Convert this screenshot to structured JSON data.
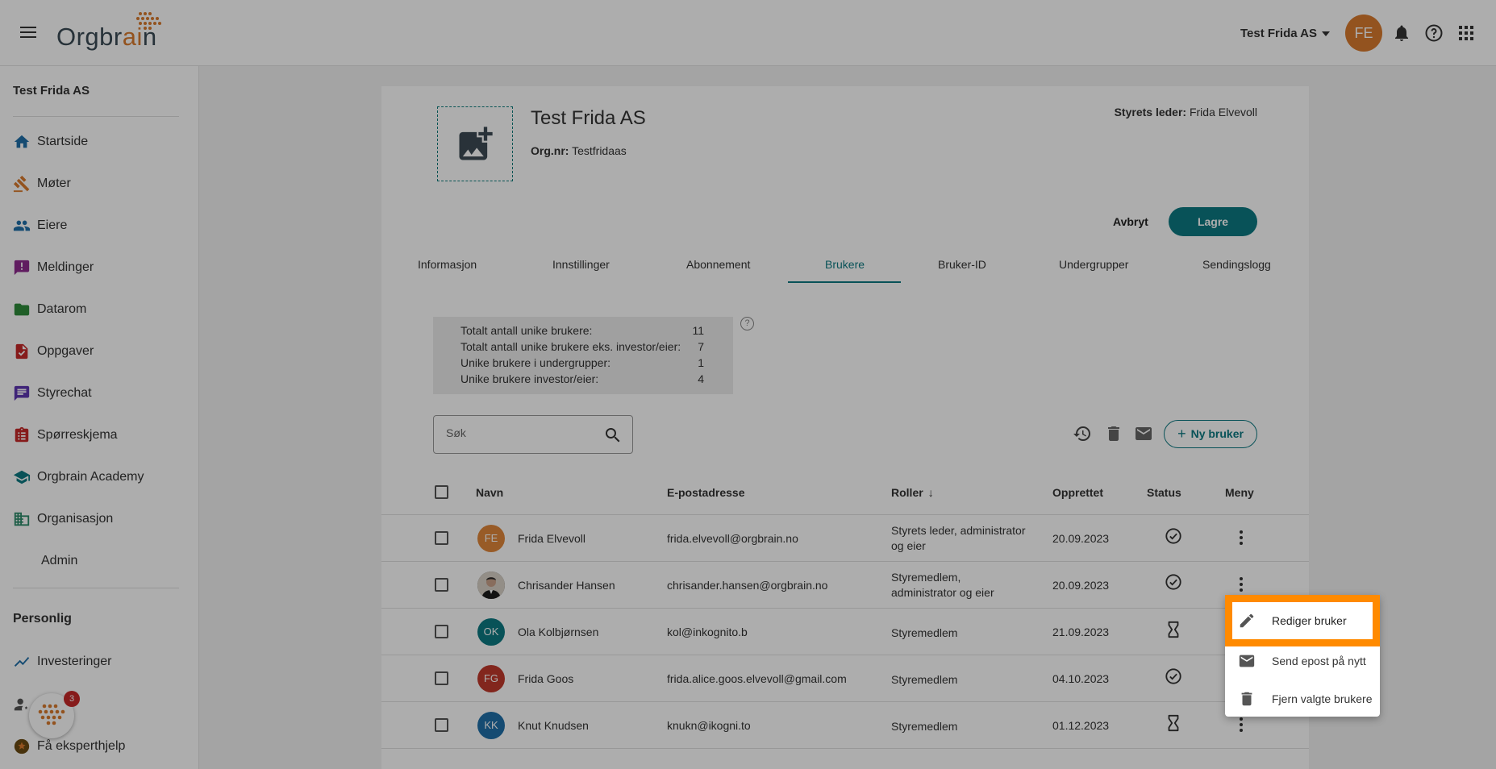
{
  "header": {
    "logo_text_a": "Orgbr",
    "logo_text_b": "ai",
    "logo_text_c": "n",
    "org_selector": "Test Frida AS",
    "avatar_initials": "FE"
  },
  "sidebar": {
    "org_name": "Test Frida AS",
    "items": [
      {
        "label": "Startside",
        "icon": "home-icon"
      },
      {
        "label": "Møter",
        "icon": "gavel-icon"
      },
      {
        "label": "Eiere",
        "icon": "people-icon"
      },
      {
        "label": "Meldinger",
        "icon": "announcement-icon"
      },
      {
        "label": "Datarom",
        "icon": "folder-icon"
      },
      {
        "label": "Oppgaver",
        "icon": "task-icon"
      },
      {
        "label": "Styrechat",
        "icon": "chat-icon"
      },
      {
        "label": "Spørreskjema",
        "icon": "clipboard-icon"
      },
      {
        "label": "Orgbrain Academy",
        "icon": "school-icon"
      },
      {
        "label": "Organisasjon",
        "icon": "organization-icon"
      }
    ],
    "sub_item": "Admin",
    "personal_section": "Personlig",
    "personal_items": [
      {
        "label": "Investeringer",
        "icon": "chart-icon"
      },
      {
        "label": "Få eksperthjelp",
        "icon": "expert-icon"
      }
    ],
    "help_badge": "3"
  },
  "company": {
    "name": "Test Frida AS",
    "orgnr_label": "Org.nr:",
    "orgnr_value": "Testfridaas",
    "chair_label": "Styrets leder:",
    "chair_value": "Frida Elvevoll"
  },
  "actions": {
    "cancel": "Avbryt",
    "save": "Lagre"
  },
  "tabs": [
    {
      "label": "Informasjon",
      "active": false
    },
    {
      "label": "Innstillinger",
      "active": false
    },
    {
      "label": "Abonnement",
      "active": false
    },
    {
      "label": "Brukere",
      "active": true
    },
    {
      "label": "Bruker-ID",
      "active": false
    },
    {
      "label": "Undergrupper",
      "active": false
    },
    {
      "label": "Sendingslogg",
      "active": false
    }
  ],
  "stats": [
    {
      "label": "Totalt antall unike brukere:",
      "value": "11"
    },
    {
      "label": "Totalt antall unike brukere eks. investor/eier:",
      "value": "7"
    },
    {
      "label": "Unike brukere i undergrupper:",
      "value": "1"
    },
    {
      "label": "Unike brukere investor/eier:",
      "value": "4"
    }
  ],
  "stats_help": "?",
  "search": {
    "placeholder": "Søk"
  },
  "new_user_button": "Ny bruker",
  "table": {
    "headers": {
      "name": "Navn",
      "email": "E-postadresse",
      "roles": "Roller",
      "created": "Opprettet",
      "status": "Status",
      "menu": "Meny"
    },
    "rows": [
      {
        "initials": "FE",
        "color": "#e0873a",
        "name": "Frida Elvevoll",
        "email": "frida.elvevoll@orgbrain.no",
        "role": "Styrets leder, administrator og eier",
        "created": "20.09.2023",
        "status": "check"
      },
      {
        "initials": "",
        "color": "#3a3a3a",
        "name": "Chrisander Hansen",
        "email": "chrisander.hansen@orgbrain.no",
        "role": "Styremedlem, administrator og eier",
        "created": "20.09.2023",
        "status": "check"
      },
      {
        "initials": "OK",
        "color": "#0d7a82",
        "name": "Ola Kolbjørnsen",
        "email": "kol@inkognito.b",
        "role": "Styremedlem",
        "created": "21.09.2023",
        "status": "pending"
      },
      {
        "initials": "FG",
        "color": "#c0392b",
        "name": "Frida Goos",
        "email": "frida.alice.goos.elvevoll@gmail.com",
        "role": "Styremedlem",
        "created": "04.10.2023",
        "status": "check"
      },
      {
        "initials": "KK",
        "color": "#1f6fa8",
        "name": "Knut Knudsen",
        "email": "knukn@ikogni.to",
        "role": "Styremedlem",
        "created": "01.12.2023",
        "status": "pending"
      }
    ]
  },
  "context_menu": {
    "edit": "Rediger bruker",
    "resend": "Send epost på nytt",
    "remove": "Fjern valgte brukere"
  },
  "colors": {
    "accent": "#0d7a82",
    "brand_orange": "#d97b2e",
    "highlight": "#ff8a00"
  }
}
